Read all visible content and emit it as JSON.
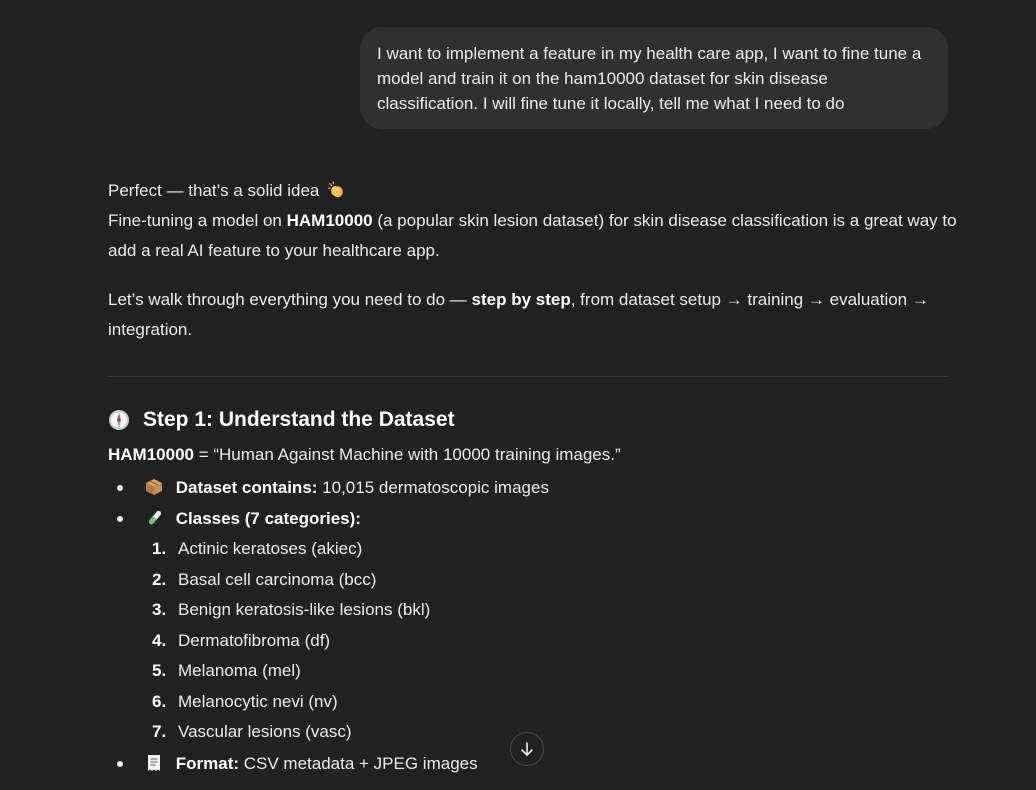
{
  "user_message": {
    "text": "I want to implement a feature in my health care app, I want to fine tune a model and train it on the ham10000 dataset for skin disease classification. I will fine tune it locally, tell me what I need to do"
  },
  "assistant": {
    "intro_line1": "Perfect — that’s a solid idea",
    "intro_line1_icon": "clapping-hands-icon",
    "intro_p1_prefix": "Fine-tuning a model on ",
    "intro_p1_bold": "HAM10000",
    "intro_p1_suffix": " (a popular skin lesion dataset) for skin disease classification is a great way to add a real AI feature to your healthcare app.",
    "intro_p2_prefix": "Let’s walk through everything you need to do — ",
    "intro_p2_bold": "step by step",
    "intro_p2_suffix": ", from dataset setup → training → evaluation → integration.",
    "step1": {
      "icon": "compass-icon",
      "heading": "Step 1: Understand the Dataset",
      "def_bold": "HAM10000",
      "def_text": " = “Human Against Machine with 10000 training images.”",
      "bullet_contains_icon": "package-icon",
      "bullet_contains_label": "Dataset contains:",
      "bullet_contains_text": " 10,015 dermatoscopic images",
      "bullet_classes_icon": "test-tube-icon",
      "bullet_classes_label": "Classes (7 categories):",
      "classes": [
        {
          "num": "1.",
          "text": "Actinic keratoses (akiec)"
        },
        {
          "num": "2.",
          "text": "Basal cell carcinoma (bcc)"
        },
        {
          "num": "3.",
          "text": "Benign keratosis-like lesions (bkl)"
        },
        {
          "num": "4.",
          "text": "Dermatofibroma (df)"
        },
        {
          "num": "5.",
          "text": "Melanoma (mel)"
        },
        {
          "num": "6.",
          "text": "Melanocytic nevi (nv)"
        },
        {
          "num": "7.",
          "text": "Vascular lesions (vasc)"
        }
      ],
      "bullet_format_icon": "receipt-icon",
      "bullet_format_label": "Format:",
      "bullet_format_text": " CSV metadata + JPEG images"
    }
  },
  "scroll_button": {
    "icon": "arrow-down-icon"
  },
  "colors": {
    "background": "#212121",
    "user_bubble": "#303030",
    "text": "#ececec",
    "divider": "#3e3e3e"
  }
}
